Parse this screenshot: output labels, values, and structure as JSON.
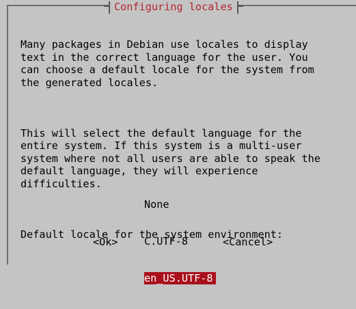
{
  "dialog": {
    "title": "Configuring locales",
    "paragraphs": [
      "Many packages in Debian use locales to display\ntext in the correct language for the user. You\ncan choose a default locale for the system from\nthe generated locales.",
      "This will select the default language for the\nentire system. If this system is a multi-user\nsystem where not all users are able to speak the\ndefault language, they will experience\ndifficulties.",
      "Default locale for the system environment:"
    ],
    "options": [
      "None",
      "C.UTF-8",
      "en_US.UTF-8"
    ],
    "selected_option": "en_US.UTF-8",
    "buttons": {
      "ok": "<Ok>",
      "cancel": "<Cancel>"
    }
  },
  "colors": {
    "background": "#c4c4c4",
    "title_text": "#b3262e",
    "selection_bg": "#a8101c",
    "selection_text": "#ffffff"
  }
}
